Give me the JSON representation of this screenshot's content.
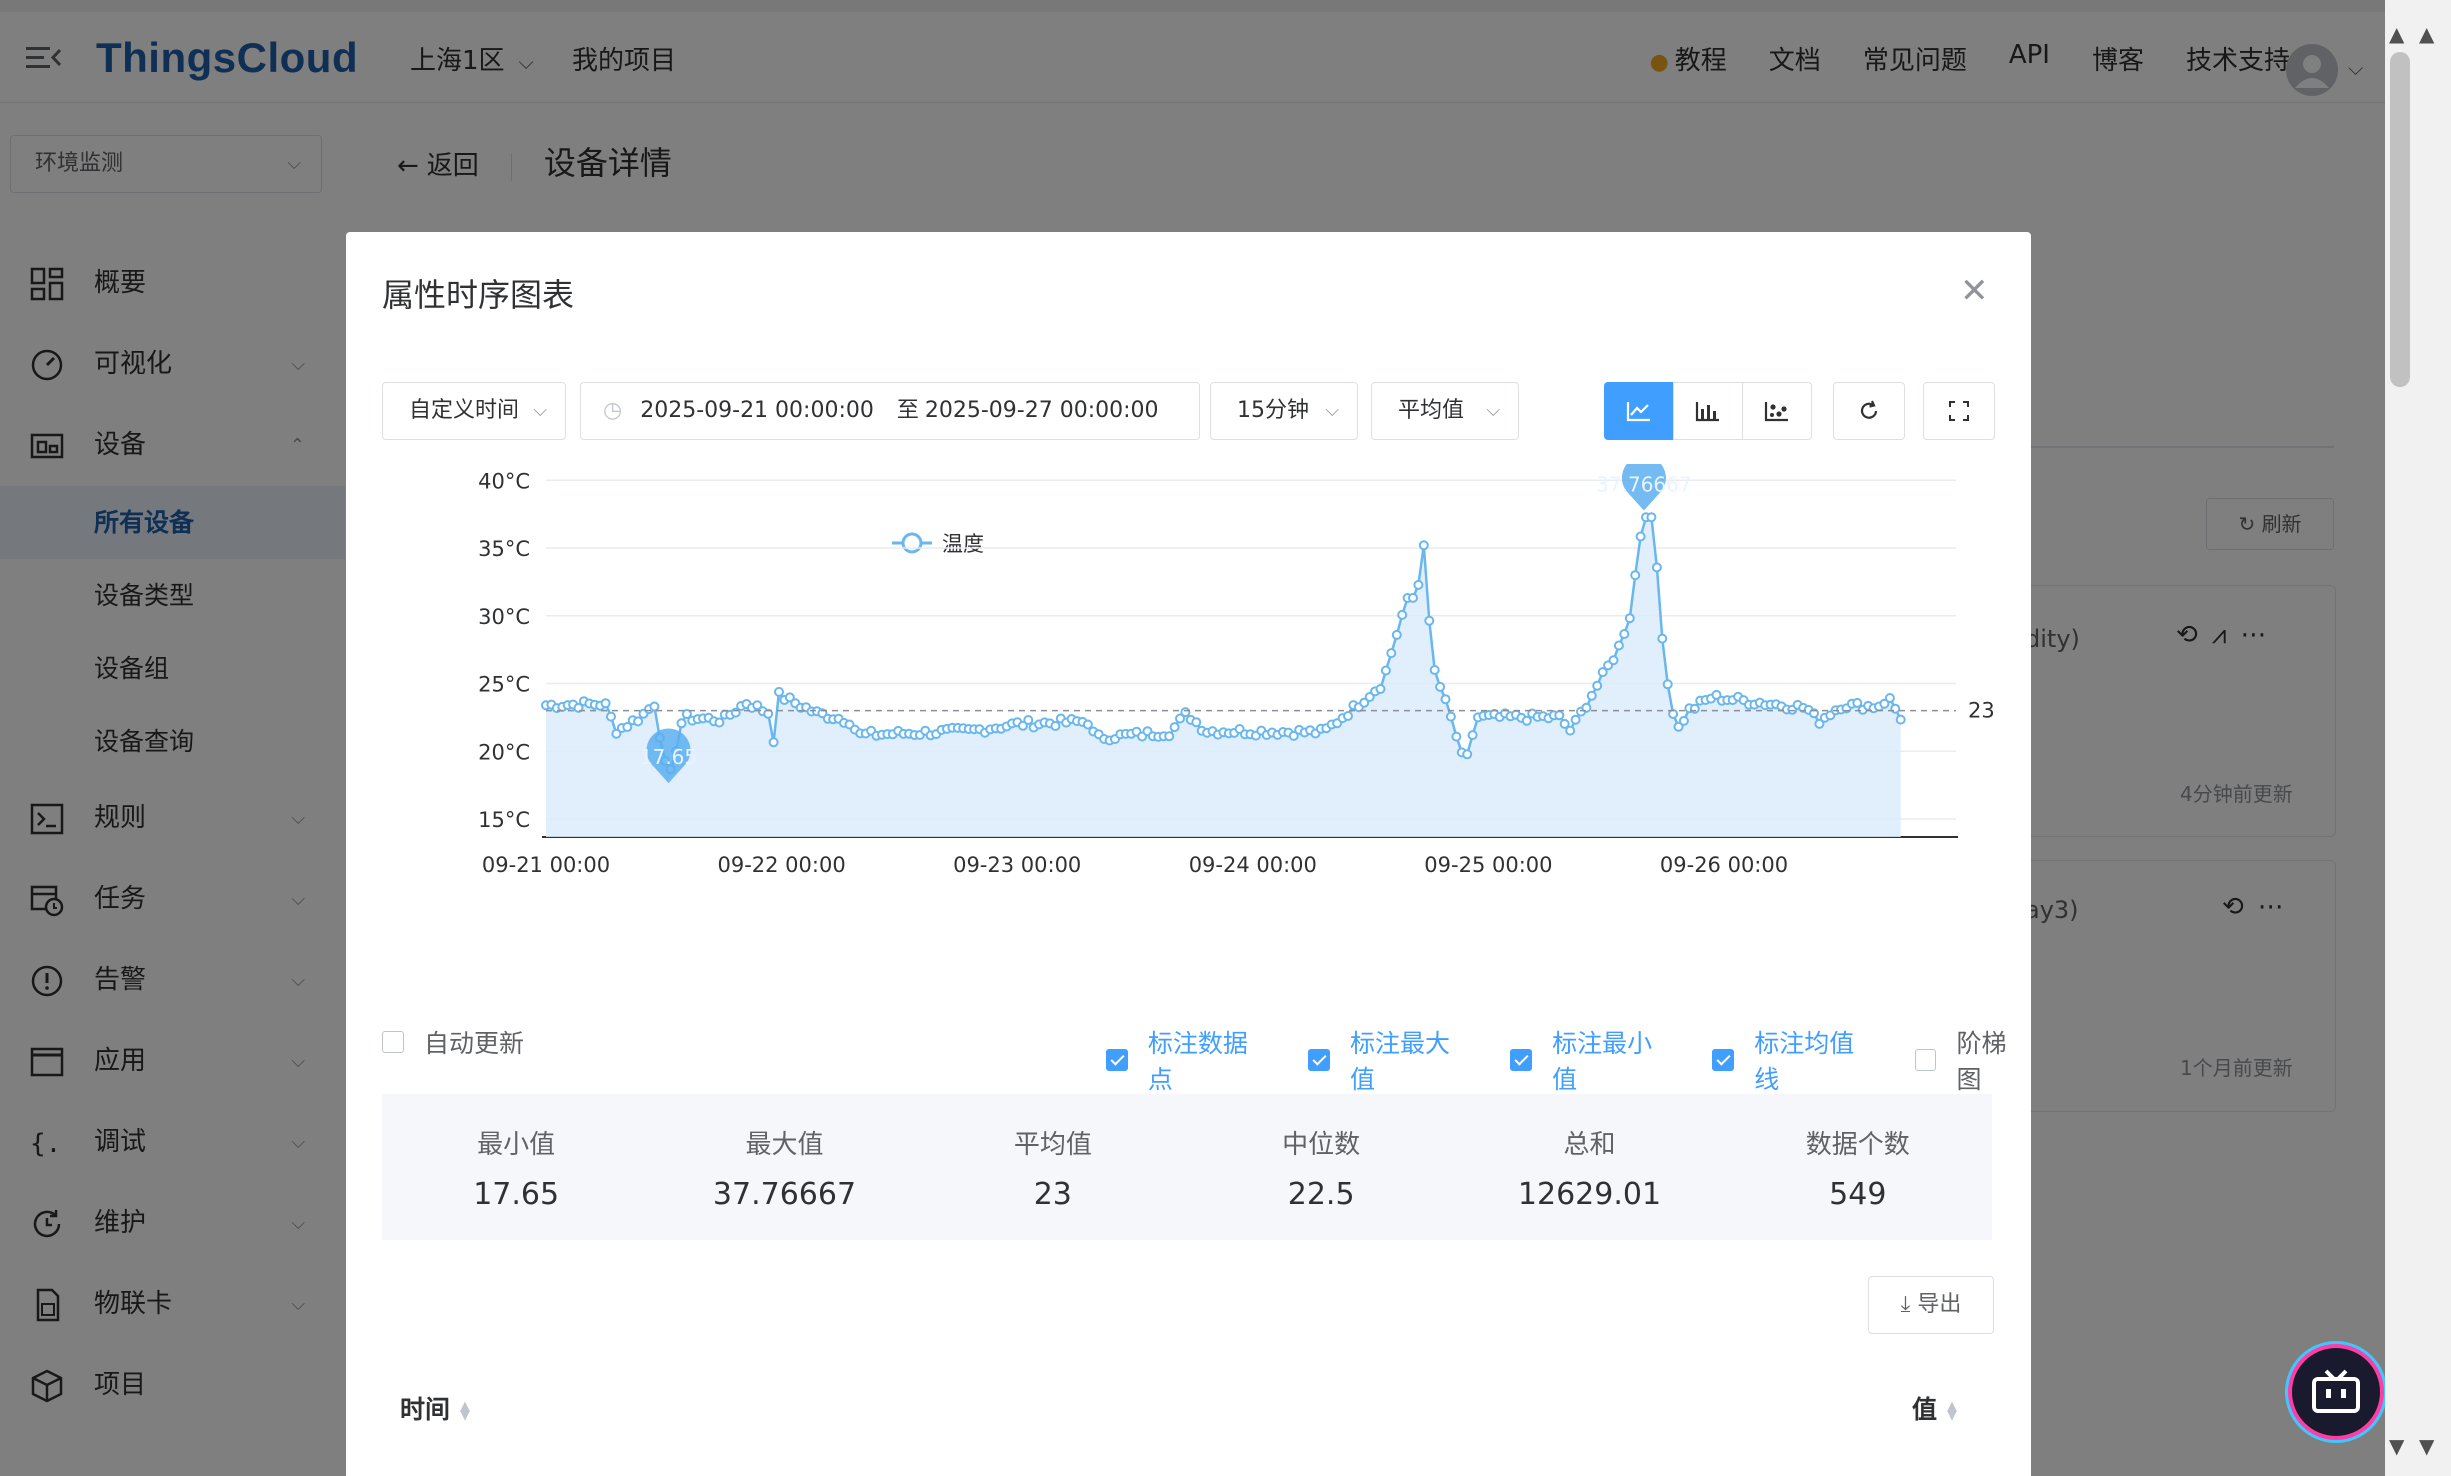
{
  "topbar": {
    "logo": "ThingsCloud",
    "region": "上海1区",
    "my_projects": "我的项目",
    "nav": [
      "教程",
      "文档",
      "常见问题",
      "API",
      "博客",
      "技术支持"
    ]
  },
  "sidebar": {
    "project": "环境监测",
    "items": [
      {
        "label": "概要"
      },
      {
        "label": "可视化"
      },
      {
        "label": "设备"
      },
      {
        "label": "规则"
      },
      {
        "label": "任务"
      },
      {
        "label": "告警"
      },
      {
        "label": "应用"
      },
      {
        "label": "调试"
      },
      {
        "label": "维护"
      },
      {
        "label": "物联卡"
      },
      {
        "label": "项目"
      }
    ],
    "device_sub": [
      "所有设备",
      "设备类型",
      "设备组",
      "设备查询"
    ]
  },
  "main": {
    "back": "返回",
    "title": "设备详情",
    "refresh": "刷新",
    "card1_text": "dity)",
    "card1_time": "4分钟前更新",
    "card2_text": "ay3)",
    "card2_time": "1个月前更新"
  },
  "dialog": {
    "title": "属性时序图表",
    "range_mode": "自定义时间",
    "start": "2025-09-21 00:00:00",
    "to": "至",
    "end": "2025-09-27 00:00:00",
    "interval": "15分钟",
    "aggregate": "平均值",
    "options": {
      "auto_update": "自动更新",
      "mark_points": "标注数据点",
      "mark_max": "标注最大值",
      "mark_min": "标注最小值",
      "mark_avg": "标注均值线",
      "step": "阶梯图"
    },
    "stats": [
      {
        "label": "最小值",
        "value": "17.65"
      },
      {
        "label": "最大值",
        "value": "37.76667"
      },
      {
        "label": "平均值",
        "value": "23"
      },
      {
        "label": "中位数",
        "value": "22.5"
      },
      {
        "label": "总和",
        "value": "12629.01"
      },
      {
        "label": "数据个数",
        "value": "549"
      }
    ],
    "export": "导出",
    "col_time": "时间",
    "col_value": "值"
  },
  "colors": {
    "accent": "#409eff",
    "line": "#6ab7ee",
    "area": "#dcecfb",
    "brand": "#1f5ea8"
  },
  "chart_data": {
    "type": "line",
    "legend": [
      "温度"
    ],
    "series": [
      {
        "name": "温度"
      }
    ],
    "y_tick_labels": [
      "15°C",
      "20°C",
      "25°C",
      "30°C",
      "35°C",
      "40°C"
    ],
    "ylim": [
      14,
      40.5
    ],
    "x_tick_labels": [
      "09-21 00:00",
      "09-22 00:00",
      "09-23 00:00",
      "09-24 00:00",
      "09-25 00:00",
      "09-26 00:00"
    ],
    "xlim_days": [
      0,
      6
    ],
    "max_label": "37.76667",
    "max_point": {
      "day": 4.66,
      "value": 37.76667
    },
    "min_label": "17.65",
    "min_point": {
      "day": 0.52,
      "value": 17.65
    },
    "avg_label": "23",
    "avg": 23,
    "profile": [
      [
        0.0,
        23.4
      ],
      [
        0.25,
        23.5
      ],
      [
        0.3,
        21.5
      ],
      [
        0.4,
        22.5
      ],
      [
        0.46,
        23.5
      ],
      [
        0.52,
        17.65
      ],
      [
        0.58,
        22.5
      ],
      [
        0.75,
        22.3
      ],
      [
        0.85,
        23.6
      ],
      [
        0.95,
        22.8
      ],
      [
        0.96,
        19.5
      ],
      [
        0.98,
        24.2
      ],
      [
        1.15,
        22.8
      ],
      [
        1.3,
        22.2
      ],
      [
        1.32,
        21.2
      ],
      [
        1.5,
        21.3
      ],
      [
        1.8,
        21.5
      ],
      [
        2.0,
        22.0
      ],
      [
        2.3,
        22.2
      ],
      [
        2.33,
        21.0
      ],
      [
        2.65,
        21.4
      ],
      [
        2.72,
        22.8
      ],
      [
        2.8,
        21.5
      ],
      [
        3.3,
        21.4
      ],
      [
        3.45,
        23.5
      ],
      [
        3.55,
        25.0
      ],
      [
        3.65,
        31.0
      ],
      [
        3.7,
        31.5
      ],
      [
        3.72,
        37.0
      ],
      [
        3.76,
        26.5
      ],
      [
        3.85,
        22.0
      ],
      [
        3.9,
        18.8
      ],
      [
        3.95,
        22.5
      ],
      [
        4.3,
        22.5
      ],
      [
        4.35,
        21.5
      ],
      [
        4.45,
        24.5
      ],
      [
        4.55,
        27.5
      ],
      [
        4.6,
        30.0
      ],
      [
        4.66,
        37.77
      ],
      [
        4.7,
        36.8
      ],
      [
        4.75,
        26.0
      ],
      [
        4.8,
        21.5
      ],
      [
        4.85,
        23.0
      ],
      [
        4.95,
        24.0
      ],
      [
        5.35,
        23.2
      ],
      [
        5.4,
        22.2
      ],
      [
        5.5,
        23.4
      ],
      [
        5.65,
        23.3
      ],
      [
        5.7,
        23.9
      ],
      [
        5.75,
        22.5
      ]
    ]
  }
}
